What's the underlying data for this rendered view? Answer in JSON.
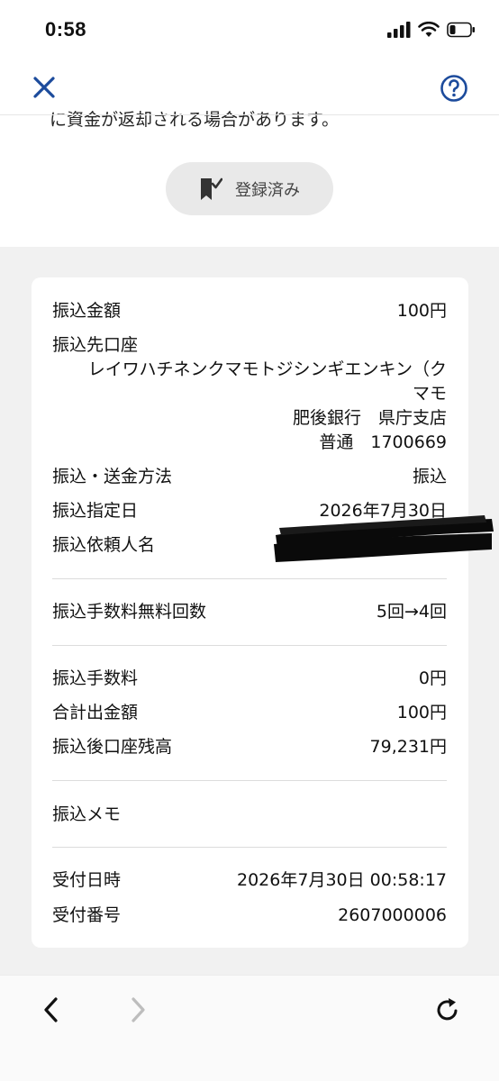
{
  "status_bar": {
    "time": "0:58"
  },
  "top_text_cut": "に資金が返却される場合があります。",
  "registered_button": {
    "label": "登録済み"
  },
  "details": {
    "amount": {
      "label": "振込金額",
      "value": "100円"
    },
    "destination": {
      "label": "振込先口座",
      "name_line1": "レイワハチネンクマモトジシンギエンキン（ク",
      "name_line2": "マモ",
      "bank": "肥後銀行　県庁支店",
      "account": "普通　1700669"
    },
    "method": {
      "label": "振込・送金方法",
      "value": "振込"
    },
    "date": {
      "label": "振込指定日",
      "value": "2026年7月30日"
    },
    "requester": {
      "label": "振込依頼人名"
    },
    "free_count": {
      "label": "振込手数料無料回数",
      "value": "5回→4回"
    },
    "fee": {
      "label": "振込手数料",
      "value": "0円"
    },
    "total": {
      "label": "合計出金額",
      "value": "100円"
    },
    "balance": {
      "label": "振込後口座残高",
      "value": "79,231円"
    },
    "memo": {
      "label": "振込メモ"
    },
    "received_at": {
      "label": "受付日時",
      "value": "2026年7月30日 00:58:17"
    },
    "receipt_no": {
      "label": "受付番号",
      "value": "2607000006"
    }
  },
  "colors": {
    "accent": "#1c4b9c",
    "background_gray": "#f1f1f1"
  }
}
